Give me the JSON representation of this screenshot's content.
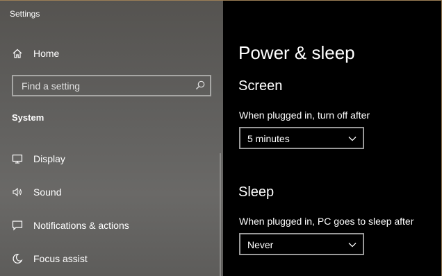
{
  "window": {
    "title": "Settings"
  },
  "sidebar": {
    "home_label": "Home",
    "search": {
      "placeholder": "Find a setting"
    },
    "section_heading": "System",
    "items": [
      {
        "label": "Display",
        "icon": "monitor-icon"
      },
      {
        "label": "Sound",
        "icon": "speaker-icon"
      },
      {
        "label": "Notifications & actions",
        "icon": "notification-icon"
      },
      {
        "label": "Focus assist",
        "icon": "moon-icon"
      }
    ]
  },
  "main": {
    "page_title": "Power & sleep",
    "screen": {
      "heading": "Screen",
      "label": "When plugged in, turn off after",
      "value": "5 minutes"
    },
    "sleep": {
      "heading": "Sleep",
      "label": "When plugged in, PC goes to sleep after",
      "value": "Never"
    }
  },
  "colors": {
    "content_bg": "#000000",
    "sidebar_bg": "#5f5e5c",
    "text": "#ffffff",
    "window_border": "#9c7f56"
  }
}
